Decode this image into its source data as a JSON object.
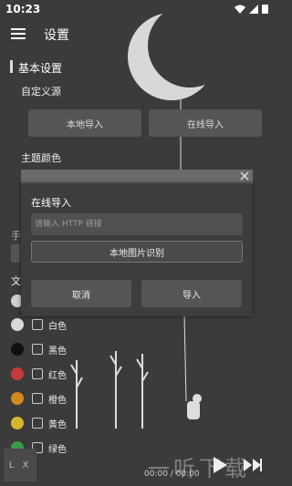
{
  "status": {
    "time": "10:23"
  },
  "header": {
    "title": "设置"
  },
  "section": {
    "title": "基本设置"
  },
  "source": {
    "label": "自定义源",
    "local_button": "本地导入",
    "online_button": "在线导入"
  },
  "theme": {
    "label": "主题颜色",
    "colors": [
      {
        "name": "白色",
        "color": "#d9d9d9"
      },
      {
        "name": "黑色",
        "color": "#101010"
      },
      {
        "name": "红色",
        "color": "#c83a3a"
      },
      {
        "name": "橙色",
        "color": "#d4891f"
      },
      {
        "name": "黄色",
        "color": "#d9b52a"
      },
      {
        "name": "绿色",
        "color": "#3a9a4a"
      }
    ],
    "partial_first_color": "#cfcfcf"
  },
  "side_text": {
    "a": "手",
    "b": "文"
  },
  "dialog": {
    "title": "在线导入",
    "placeholder": "请输入 HTTP 链接",
    "image_button": "本地图片识别",
    "cancel": "取消",
    "confirm": "导入"
  },
  "player": {
    "logo": "L X",
    "time": "00:00 / 00:00"
  },
  "watermark": {
    "text": "一听下载"
  }
}
